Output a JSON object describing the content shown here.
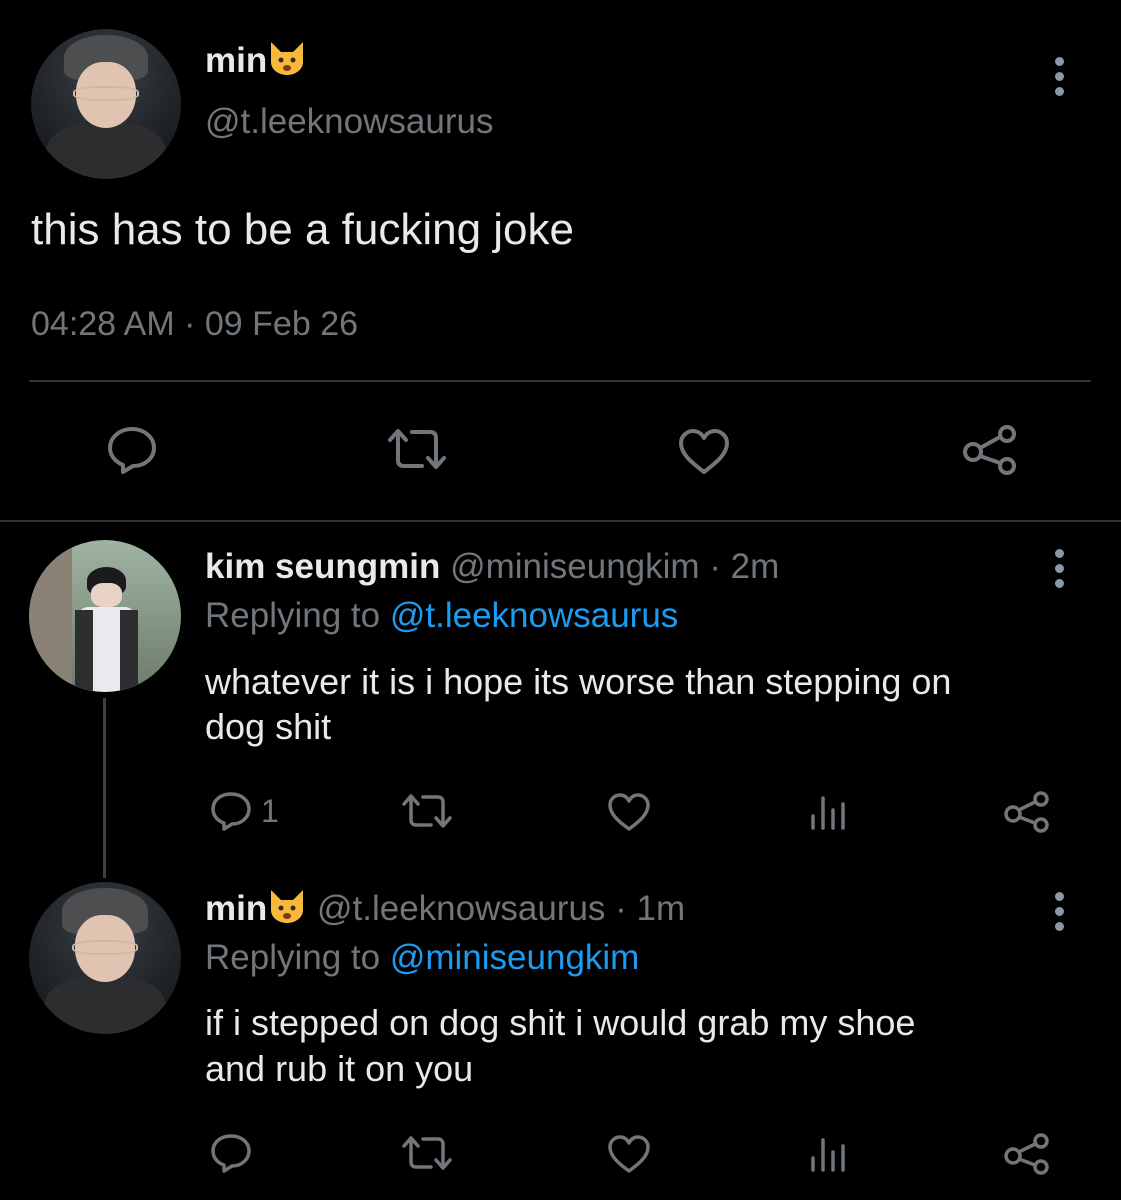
{
  "main_tweet": {
    "display_name": "min",
    "handle": "@t.leeknowsaurus",
    "text": "this has to be a fucking joke",
    "time": "04:28 AM",
    "separator": "·",
    "date": "09 Feb 26"
  },
  "replies": [
    {
      "display_name": "kim seungmin",
      "handle": "@miniseungkim",
      "age": "· 2m",
      "replying_label": "Replying to",
      "replying_to": "@t.leeknowsaurus",
      "text_line1": "whatever it is i hope its worse than stepping on",
      "text_line2": "dog shit",
      "reply_count": "1"
    },
    {
      "display_name": "min",
      "handle": "@t.leeknowsaurus",
      "age": "· 1m",
      "replying_label": "Replying to",
      "replying_to": "@miniseungkim",
      "text_line1": "if i stepped on dog shit i would grab my shoe",
      "text_line2": "and rub it on you"
    }
  ],
  "icons": {
    "emoji": "weary-cat-emoji",
    "reply": "reply-icon",
    "retweet": "retweet-icon",
    "like": "heart-icon",
    "share": "share-icon",
    "views": "analytics-icon",
    "more": "more-options-icon"
  },
  "colors": {
    "background": "#000000",
    "text": "#e7e9ea",
    "muted": "#71767b",
    "link": "#1d9bf0"
  }
}
